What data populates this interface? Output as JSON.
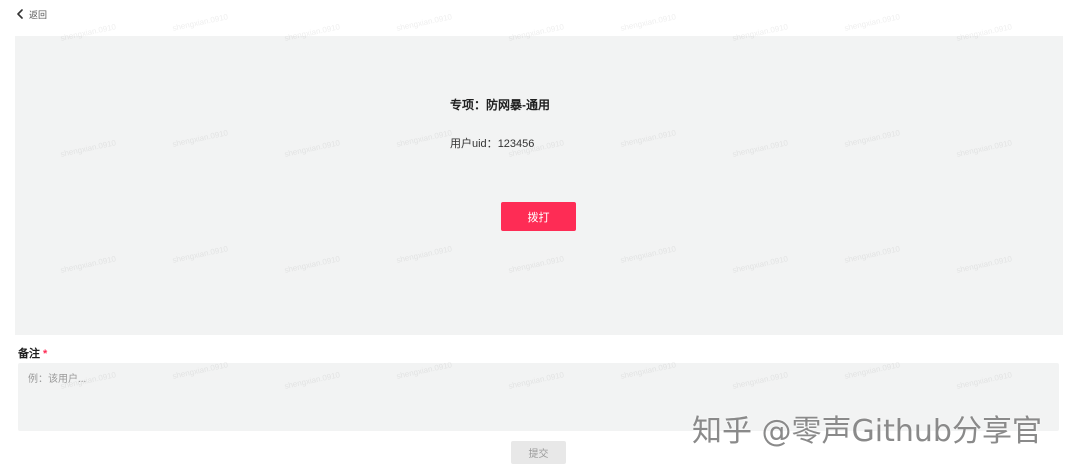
{
  "nav": {
    "back_label": "返回",
    "back_icon": "chevron-left-icon"
  },
  "card": {
    "title": "专项：防网暴-通用",
    "uid_label": "用户uid：",
    "uid_value": "123456",
    "call_button": "拨打"
  },
  "form": {
    "remark_label": "备注",
    "required_mark": "*",
    "remark_placeholder": "例：该用户...",
    "remark_value": "",
    "submit_label": "提交",
    "submit_disabled": true
  },
  "watermark": {
    "text": "shengxian.0910",
    "site_mark": "知乎 @零声Github分享官"
  },
  "colors": {
    "accent": "#fe2c55",
    "panel_bg": "#f2f3f3",
    "submit_disabled_bg": "#e8e8e8"
  }
}
